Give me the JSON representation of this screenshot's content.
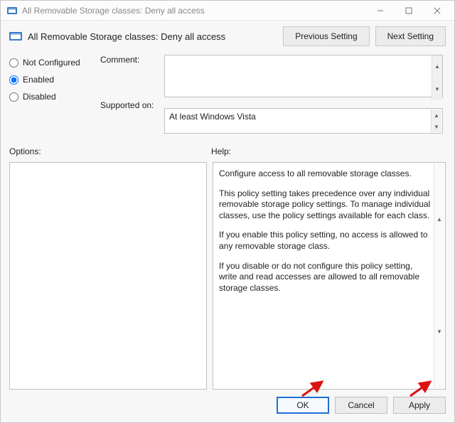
{
  "titlebar": {
    "title": "All Removable Storage classes: Deny all access"
  },
  "subheader": {
    "title": "All Removable Storage classes: Deny all access",
    "prev": "Previous Setting",
    "next": "Next Setting"
  },
  "radios": {
    "not_configured": "Not Configured",
    "enabled": "Enabled",
    "disabled": "Disabled"
  },
  "labels": {
    "comment": "Comment:",
    "supported_on": "Supported on:",
    "options": "Options:",
    "help": "Help:"
  },
  "supported_on": "At least Windows Vista",
  "help": {
    "p1": "Configure access to all removable storage classes.",
    "p2": "This policy setting takes precedence over any individual removable storage policy settings. To manage individual classes, use the policy settings available for each class.",
    "p3": "If you enable this policy setting, no access is allowed to any removable storage class.",
    "p4": "If you disable or do not configure this policy setting, write and read accesses are allowed to all removable storage classes."
  },
  "footer": {
    "ok": "OK",
    "cancel": "Cancel",
    "apply": "Apply"
  }
}
